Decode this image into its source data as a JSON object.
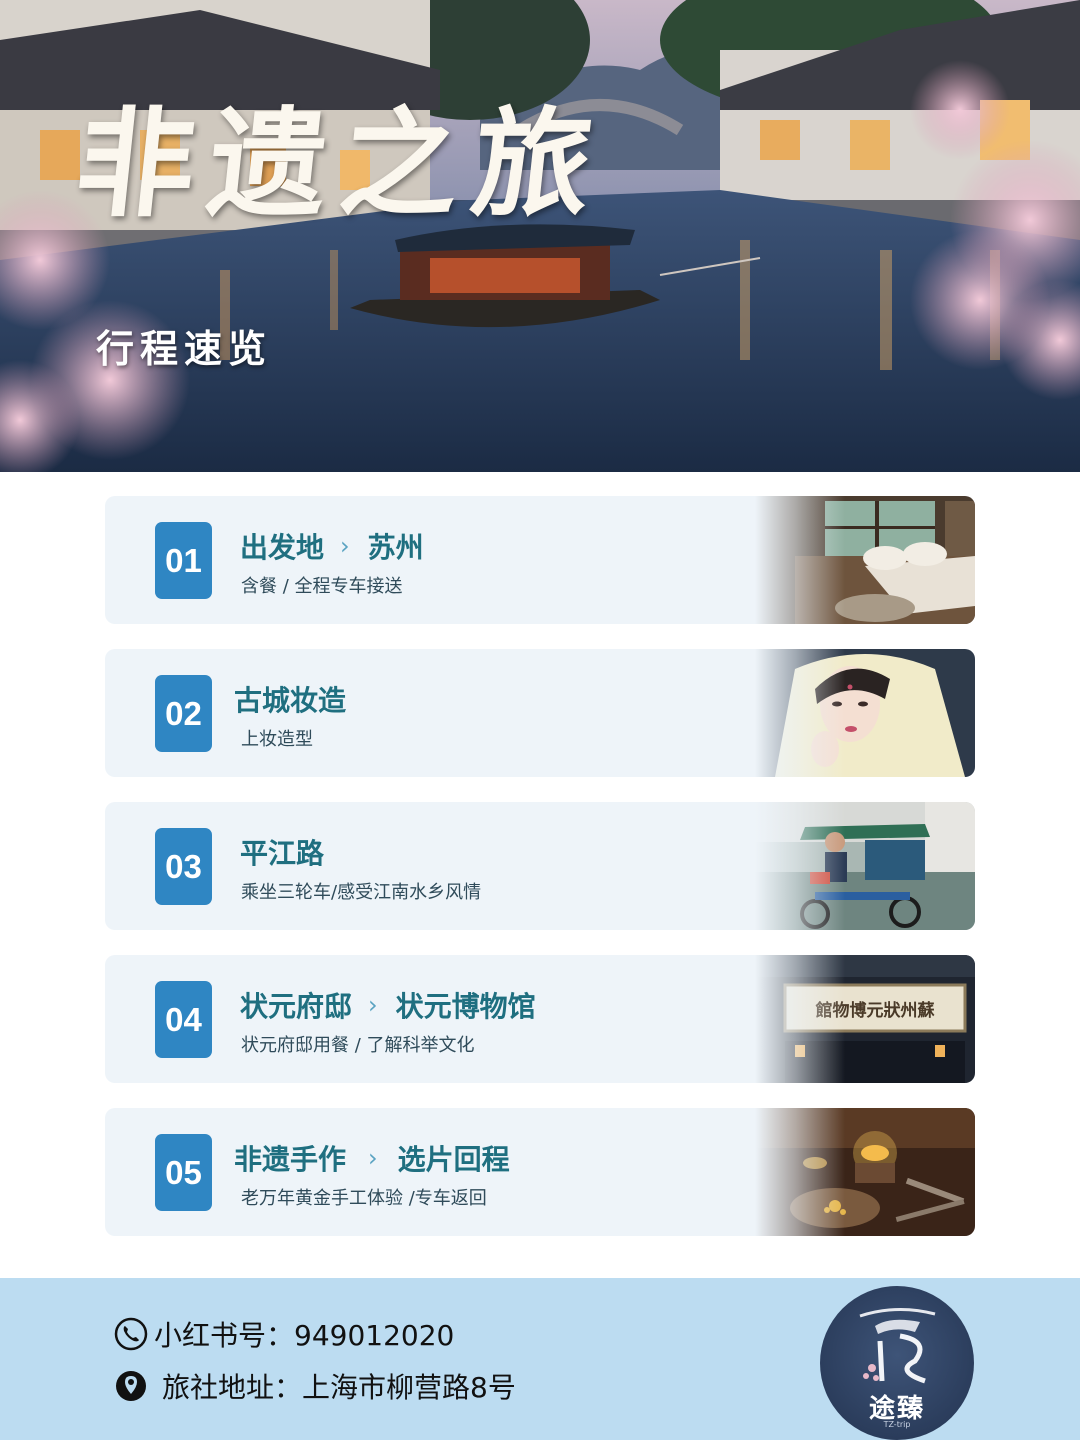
{
  "hero": {
    "title": "非遗之旅",
    "subtitle": "行程速览"
  },
  "itinerary": [
    {
      "number": "01",
      "title": "出发地",
      "arrow": "›",
      "destination": "苏州",
      "description": "含餐 / 全程专车接送",
      "image": "hotel-room-photo"
    },
    {
      "number": "02",
      "title": "古城妆造",
      "arrow": "",
      "destination": "",
      "description": "上妆造型",
      "image": "hanfu-portrait-photo"
    },
    {
      "number": "03",
      "title": "平江路",
      "arrow": "",
      "destination": "",
      "description": "乘坐三轮车/感受江南水乡风情",
      "image": "tricycle-photo"
    },
    {
      "number": "04",
      "title": "状元府邸",
      "arrow": "›",
      "destination": "状元博物馆",
      "description": "状元府邸用餐 / 了解科举文化",
      "image": "museum-sign-photo",
      "sign_text": "館物博元狀州蘇"
    },
    {
      "number": "05",
      "title": "非遗手作",
      "arrow": "›",
      "destination": "选片回程",
      "description": "老万年黄金手工体验 /专车返回",
      "image": "goldsmith-workshop-photo"
    }
  ],
  "footer": {
    "phone_icon": "phone-icon",
    "phone_label": "小红书号：949012020",
    "location_icon": "location-pin-icon",
    "address_label": "旅社地址：上海市柳营路8号",
    "logo_text": "途臻",
    "logo_sub": "TZ-trip"
  },
  "colors": {
    "badge": "#2f86c3",
    "title_teal": "#1f6f80",
    "card_bg": "#eef4f9",
    "footer_bg": "#bcdcf1",
    "logo_bg": "#2b3d5c"
  }
}
